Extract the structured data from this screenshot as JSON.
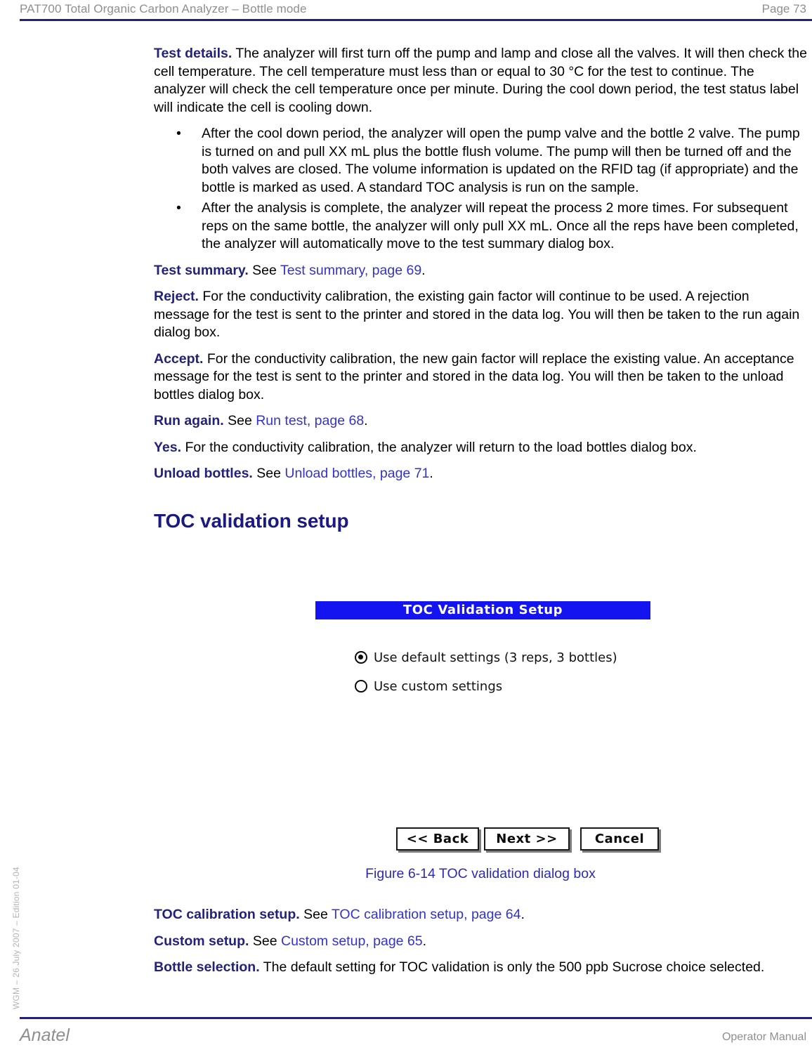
{
  "header": {
    "title": "PAT700 Total Organic Carbon Analyzer – Bottle mode",
    "page_label": "Page 73"
  },
  "spine": {
    "text": "WGM – 26 July 2007 – Edition 01-04"
  },
  "body": {
    "paragraphs": [
      {
        "lead": "Test details.",
        "text": " The analyzer will first turn off the pump and lamp and close all the valves. It will then check the cell temperature. The cell temperature must less than or equal to 30 °C for the test to continue. The analyzer will check the cell temperature once per minute. During the cool down period, the test status label will indicate the cell is cooling down."
      }
    ],
    "bullets": [
      "After the cool down period, the analyzer will open the pump valve and the bottle 2 valve. The pump is turned on and pull XX mL plus the bottle flush volume. The pump will then be turned off and the both valves are closed. The volume information is updated on the RFID tag (if appropriate) and the bottle is marked as used. A standard TOC analysis is run on the sample.",
      "After the analysis is complete, the analyzer will repeat the process 2 more times. For subsequent reps on the same bottle, the analyzer will only pull XX mL. Once all the reps have been completed, the analyzer will automatically move to the test summary dialog box."
    ],
    "bullet_glyph": "•",
    "test_summary": {
      "lead": "Test summary.",
      "see": " See ",
      "xref": "Test summary, page 69",
      "tail": "."
    },
    "reject": {
      "lead": "Reject.",
      "text": " For the conductivity calibration, the existing gain factor will continue to be used. A rejection message for the test is sent to the printer and stored in the data log. You will then be taken to the run again dialog box."
    },
    "accept": {
      "lead": "Accept.",
      "text": " For the conductivity calibration, the new gain factor will replace the existing value. An acceptance message for the test is sent to the printer and stored in the data log. You will then be taken to the unload bottles dialog box."
    },
    "run_again": {
      "lead": "Run again.",
      "see": " See ",
      "xref": "Run test, page 68",
      "tail": "."
    },
    "yes": {
      "lead": "Yes.",
      "text": " For the conductivity calibration, the analyzer will return to the load bottles dialog box."
    },
    "unload_bottles": {
      "lead": "Unload bottles.",
      "see": " See ",
      "xref": "Unload bottles, page 71",
      "tail": "."
    },
    "section_heading": "TOC validation setup"
  },
  "figure": {
    "caption": "Figure 6-14 TOC validation dialog box",
    "dialog": {
      "title": "TOC Validation Setup",
      "radio_options": [
        {
          "label": "Use default settings (3 reps, 3 bottles)",
          "selected": true
        },
        {
          "label": "Use custom settings",
          "selected": false
        }
      ],
      "buttons": [
        {
          "label": "<< Back"
        },
        {
          "label": "Next >>"
        },
        {
          "label": "Cancel"
        }
      ],
      "titlebar_color": "#1414f0"
    }
  },
  "body_tail": {
    "toc_calibration_setup": {
      "lead": "TOC calibration setup.",
      "see": " See ",
      "xref": "TOC calibration setup, page 64",
      "tail": "."
    },
    "custom_setup": {
      "lead": "Custom setup.",
      "see": " See ",
      "xref": "Custom setup, page 65",
      "tail": "."
    },
    "bottle_selection": {
      "lead": "Bottle selection.",
      "text": " The default setting for TOC validation is only the 500 ppb Sucrose choice selected."
    }
  },
  "footer": {
    "brand": "Anatel",
    "right": "Operator Manual"
  },
  "colors": {
    "rule": "#22227a",
    "heading": "#1a1a80",
    "lead": "#22227a",
    "xref": "#3333cc",
    "caption": "#2b2bb0",
    "muted": "#8f8f93"
  }
}
